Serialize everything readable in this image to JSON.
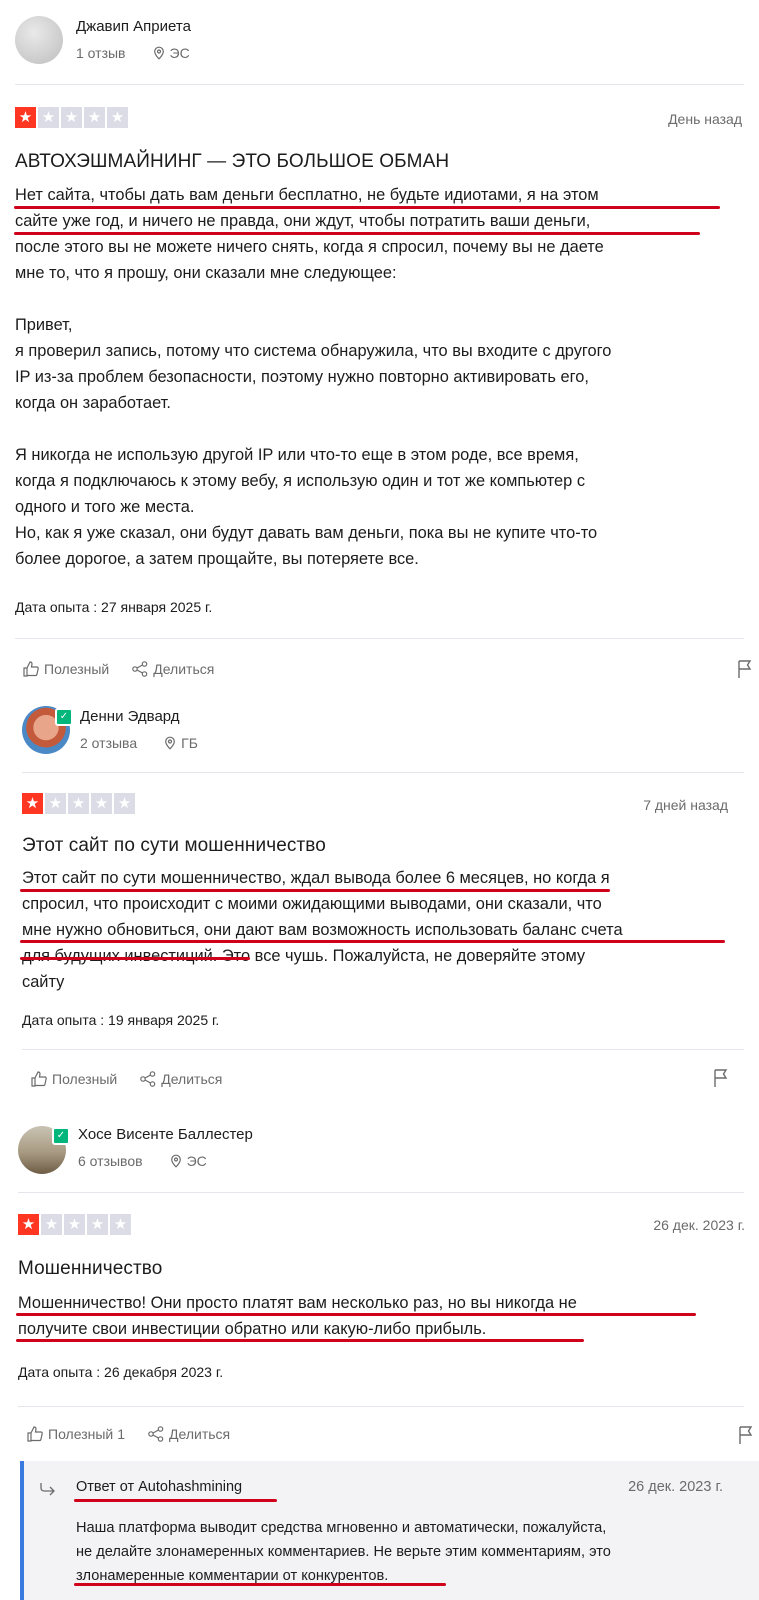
{
  "labels": {
    "helpful": "Полезный",
    "share": "Делиться"
  },
  "reviews": [
    {
      "author": "Джавип Априета",
      "reviews_count": "1 отзыв",
      "country": "ЭС",
      "rating": 1,
      "date": "День назад",
      "title": "АВТОХЭШМАЙНИНГ — ЭТО БОЛЬШОЕ ОБМАН",
      "lines": [
        "Нет сайта, чтобы дать вам деньги бесплатно, не будьте идиотами, я на этом",
        "сайте уже год, и ничего не правда, они ждут, чтобы потратить ваши деньги,",
        "после этого вы не можете ничего снять, когда я спросил, почему вы не даете",
        "мне то, что я прошу, они сказали мне следующее:",
        "",
        "Привет,",
        "я проверил запись, потому что система обнаружила, что вы входите с другого",
        "IP из-за проблем безопасности, поэтому нужно повторно активировать его,",
        "когда он заработает.",
        "",
        "Я никогда не использую другой IP или что-то еще в этом роде, все время,",
        "когда я подключаюсь к этому вебу, я использую один и тот же компьютер с",
        "одного и того же места.",
        "Но, как я уже сказал, они будут давать вам деньги, пока вы не купите что-то",
        "более дорогое, а затем прощайте, вы потеряете все."
      ],
      "experience": "Дата опыта : 27 января 2025 г.",
      "helpful_count": ""
    },
    {
      "author": "Денни Эдвард",
      "reviews_count": "2 отзыва",
      "country": "ГБ",
      "rating": 1,
      "date": "7 дней назад",
      "title": "Этот сайт по сути мошенничество",
      "lines": [
        "Этот сайт по сути мошенничество, ждал вывода более 6 месяцев, но когда я",
        "спросил, что происходит с моими ожидающими выводами, они сказали, что",
        "мне нужно обновиться, они дают вам возможность использовать баланс счета",
        "для будущих инвестиций. Это все чушь. Пожалуйста, не доверяйте этому",
        "сайту"
      ],
      "experience": "Дата опыта : 19 января 2025 г.",
      "helpful_count": ""
    },
    {
      "author": "Хосе Висенте Баллестер",
      "reviews_count": "6 отзывов",
      "country": "ЭС",
      "rating": 1,
      "date": "26 дек. 2023 г.",
      "title": "Мошенничество",
      "lines": [
        "Мошенничество! Они просто платят вам несколько раз, но вы никогда не",
        "получите свои инвестиции обратно или какую-либо прибыль."
      ],
      "experience": "Дата опыта : 26 декабря 2023 г.",
      "helpful_count": "1"
    }
  ],
  "reply": {
    "prefix": "Ответ от",
    "company": "Autohashmining",
    "date": "26 дек. 2023 г.",
    "lines": [
      "Наша платформа выводит средства мгновенно и автоматически, пожалуйста,",
      "не делайте злонамеренных комментариев. Не верьте этим комментариям, это",
      "злонамеренные комментарии от конкурентов."
    ]
  },
  "colors": {
    "star_on": "#ff3722",
    "star_off": "#dcdce6",
    "verified": "#00b67a",
    "underline": "#d0021b",
    "reply_border": "#3a7be0"
  }
}
